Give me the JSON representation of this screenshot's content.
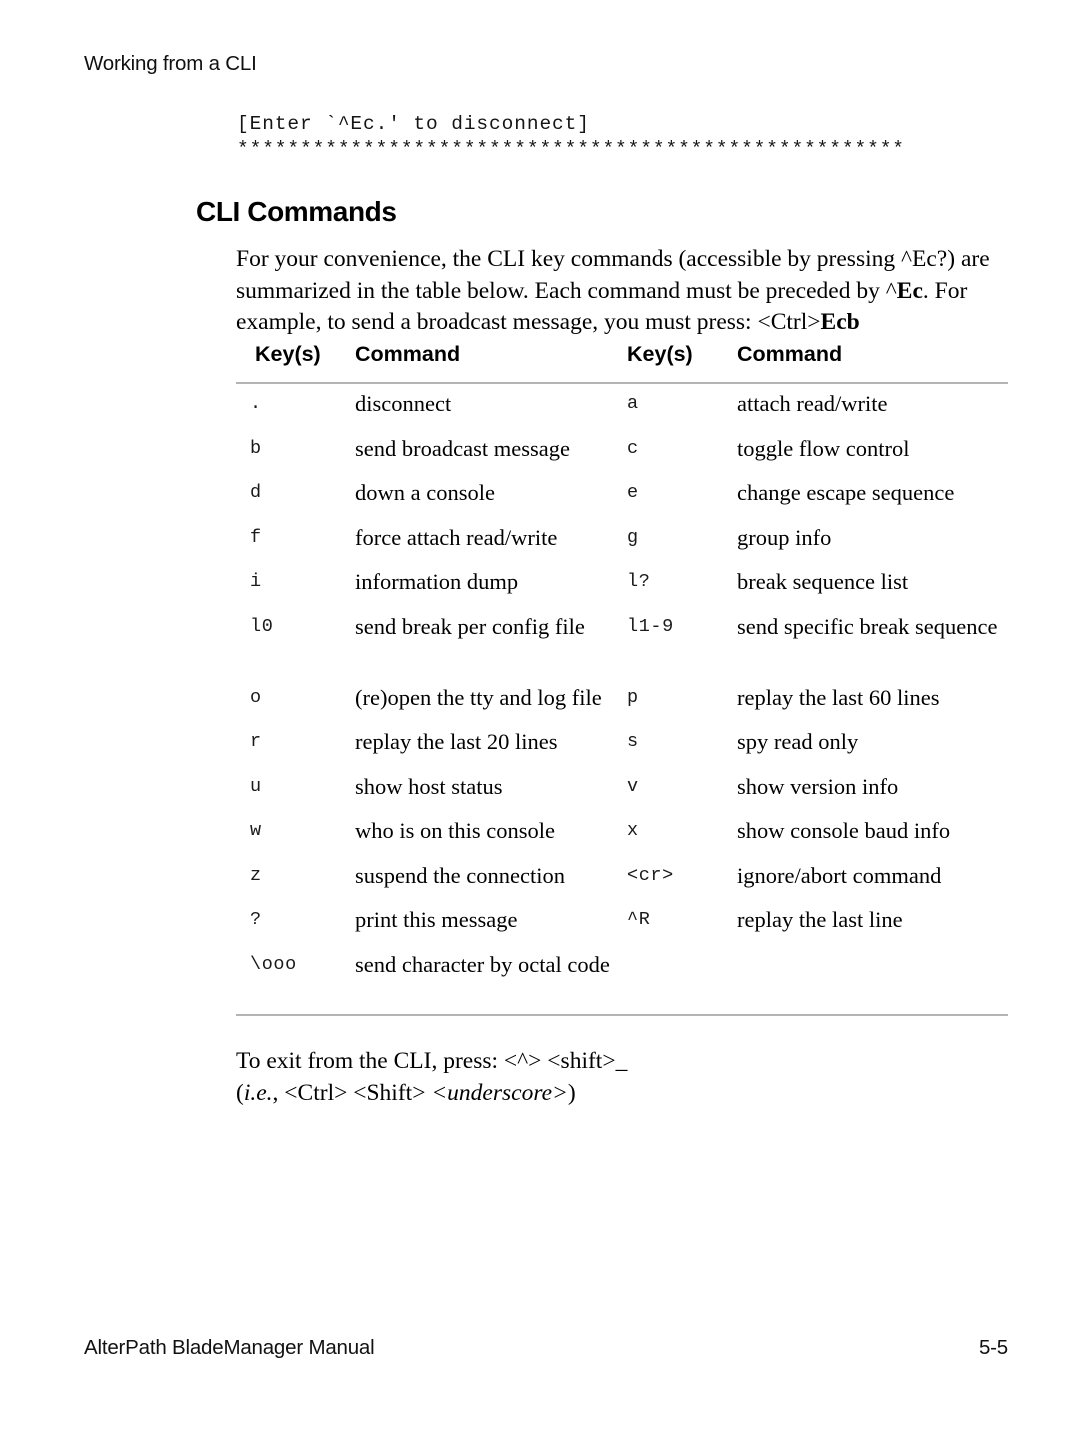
{
  "header": {
    "running_head": "Working from a CLI"
  },
  "terminal": {
    "message": "[Enter `^Ec.' to disconnect]",
    "separator": "*****************************************************"
  },
  "section": {
    "heading": "CLI Commands",
    "intro_line1": "For your convenience, the CLI key commands (accessible by pressing ^Ec?)",
    "intro_line2_a": "are summarized in the table below. Each command must be preceded by ^",
    "intro_line2_b": "Ec",
    "intro_line2_c": ".",
    "intro_line3_a": "For example, to send a broadcast message, you must press: <Ctrl>",
    "intro_line3_b": "Ecb"
  },
  "table": {
    "headers": {
      "keys_left": "Key(s)",
      "command_left": "Command",
      "keys_right": "Key(s)",
      "command_right": "Command"
    },
    "rows": [
      {
        "key_left": ".",
        "cmd_left": "disconnect",
        "key_right": "a",
        "cmd_right": "attach read/write"
      },
      {
        "key_left": "b",
        "cmd_left": "send broadcast message",
        "key_right": "c",
        "cmd_right": "toggle flow control"
      },
      {
        "key_left": "d",
        "cmd_left": "down a console",
        "key_right": "e",
        "cmd_right": "change escape sequence"
      },
      {
        "key_left": "f",
        "cmd_left": "force attach read/write",
        "key_right": "g",
        "cmd_right": "group info"
      },
      {
        "key_left": "i",
        "cmd_left": "information dump",
        "key_right": "l?",
        "cmd_right": "break sequence list"
      },
      {
        "key_left": "l0",
        "cmd_left": "send break per config file",
        "key_right": "l1-9",
        "cmd_right": "send specific break sequence"
      },
      {
        "key_left": "o",
        "cmd_left": "(re)open the tty and log file",
        "key_right": "p",
        "cmd_right": "replay the last 60 lines"
      },
      {
        "key_left": "r",
        "cmd_left": "replay the last 20 lines",
        "key_right": "s",
        "cmd_right": "spy read only"
      },
      {
        "key_left": "u",
        "cmd_left": "show host status",
        "key_right": "v",
        "cmd_right": "show version info"
      },
      {
        "key_left": "w",
        "cmd_left": "who is on this console",
        "key_right": "x",
        "cmd_right": "show console baud info"
      },
      {
        "key_left": "z",
        "cmd_left": "suspend the connection",
        "key_right": "<cr>",
        "cmd_right": "ignore/abort command"
      },
      {
        "key_left": "?",
        "cmd_left": "print this message",
        "key_right": "^R",
        "cmd_right": "replay the last line"
      },
      {
        "key_left": "\\ooo",
        "cmd_left": "send character by octal code",
        "key_right": "",
        "cmd_right": ""
      }
    ]
  },
  "closing": {
    "line1": "To exit from the CLI, press: <^> <shift>_",
    "line2_open": "(",
    "line2_ie": "i.e.",
    "line2_mid": ", <Ctrl> <Shift> ",
    "line2_italic": "<underscore>",
    "line2_close": ")"
  },
  "footer": {
    "manual_title": "AlterPath BladeManager Manual",
    "page_number": "5-5"
  },
  "colors": {
    "rule": "#b4b4b4",
    "text": "#000000",
    "background": "#ffffff"
  }
}
